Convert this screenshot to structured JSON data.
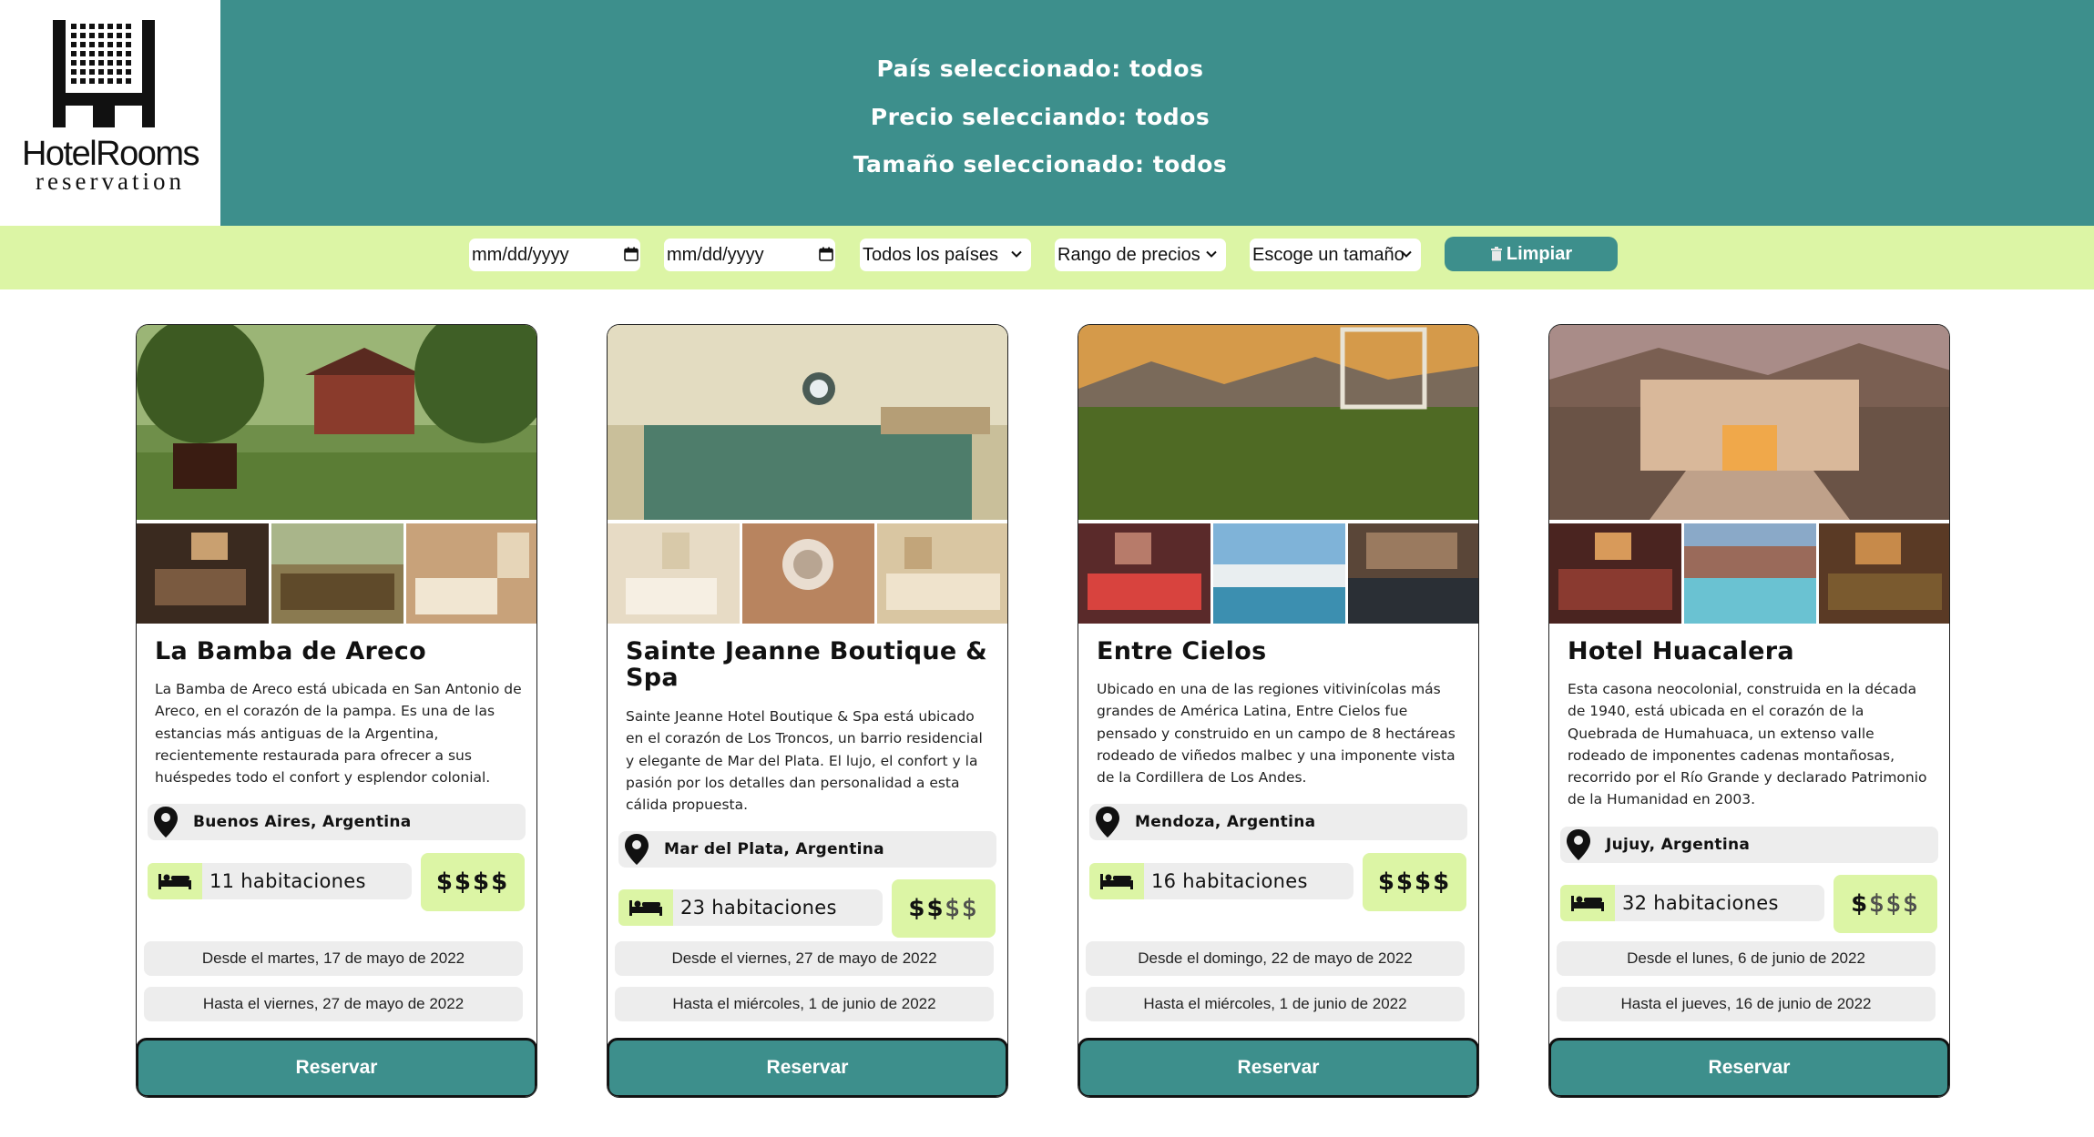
{
  "logo": {
    "name": "HotelRooms",
    "sub": "reservation"
  },
  "header": {
    "lines": [
      "País seleccionado: todos",
      "Precio selecciando: todos",
      "Tamaño seleccionado: todos"
    ]
  },
  "filters": {
    "date_from": "mm/dd/yyyy",
    "date_to": "mm/dd/yyyy",
    "country": "Todos los países",
    "price": "Rango de precios",
    "size": "Escoge un tamaño",
    "clear_label": "Limpiar"
  },
  "reserve_label": "Reservar",
  "hotels": [
    {
      "name": "La Bamba de Areco",
      "description": "La Bamba de Areco está ubicada en San Antonio de Areco, en el corazón de la pampa. Es una de las estancias más antiguas de la Argentina, recientemente restaurada para ofrecer a sus huéspedes todo el confort y esplendor colonial.",
      "location": "Buenos Aires, Argentina",
      "rooms": "11 habitaciones",
      "price_level": 4,
      "from": "Desde el martes, 17 de mayo de 2022",
      "to": "Hasta el viernes, 27 de mayo de 2022"
    },
    {
      "name": "Sainte Jeanne Boutique & Spa",
      "description": "Sainte Jeanne Hotel Boutique & Spa está ubicado en el corazón de Los Troncos, un barrio residencial y elegante de Mar del Plata. El lujo, el confort y la pasión por los detalles dan personalidad a esta cálida propuesta.",
      "location": "Mar del Plata, Argentina",
      "rooms": "23 habitaciones",
      "price_level": 2,
      "from": "Desde el viernes, 27 de mayo de 2022",
      "to": "Hasta el miércoles, 1 de junio de 2022"
    },
    {
      "name": "Entre Cielos",
      "description": "Ubicado en una de las regiones vitivinícolas más grandes de América Latina, Entre Cielos fue pensado y construido en un campo de 8 hectáreas rodeado de viñedos malbec y una imponente vista de la Cordillera de Los Andes.",
      "location": "Mendoza, Argentina",
      "rooms": "16 habitaciones",
      "price_level": 4,
      "from": "Desde el domingo, 22 de mayo de 2022",
      "to": "Hasta el miércoles, 1 de junio de 2022"
    },
    {
      "name": "Hotel Huacalera",
      "description": "Esta casona neocolonial, construida en la década de 1940, está ubicada en el corazón de la Quebrada de Humahuaca, un extenso valle rodeado de imponentes cadenas montañosas, recorrido por el Río Grande y declarado Patrimonio de la Humanidad en 2003.",
      "location": "Jujuy, Argentina",
      "rooms": "32 habitaciones",
      "price_level": 1,
      "from": "Desde el lunes, 6 de junio de 2022",
      "to": "Hasta el jueves, 16 de junio de 2022"
    }
  ],
  "colors": {
    "header": "#3d8f8c",
    "accent": "#dcf5a5",
    "pill": "#ededed"
  }
}
